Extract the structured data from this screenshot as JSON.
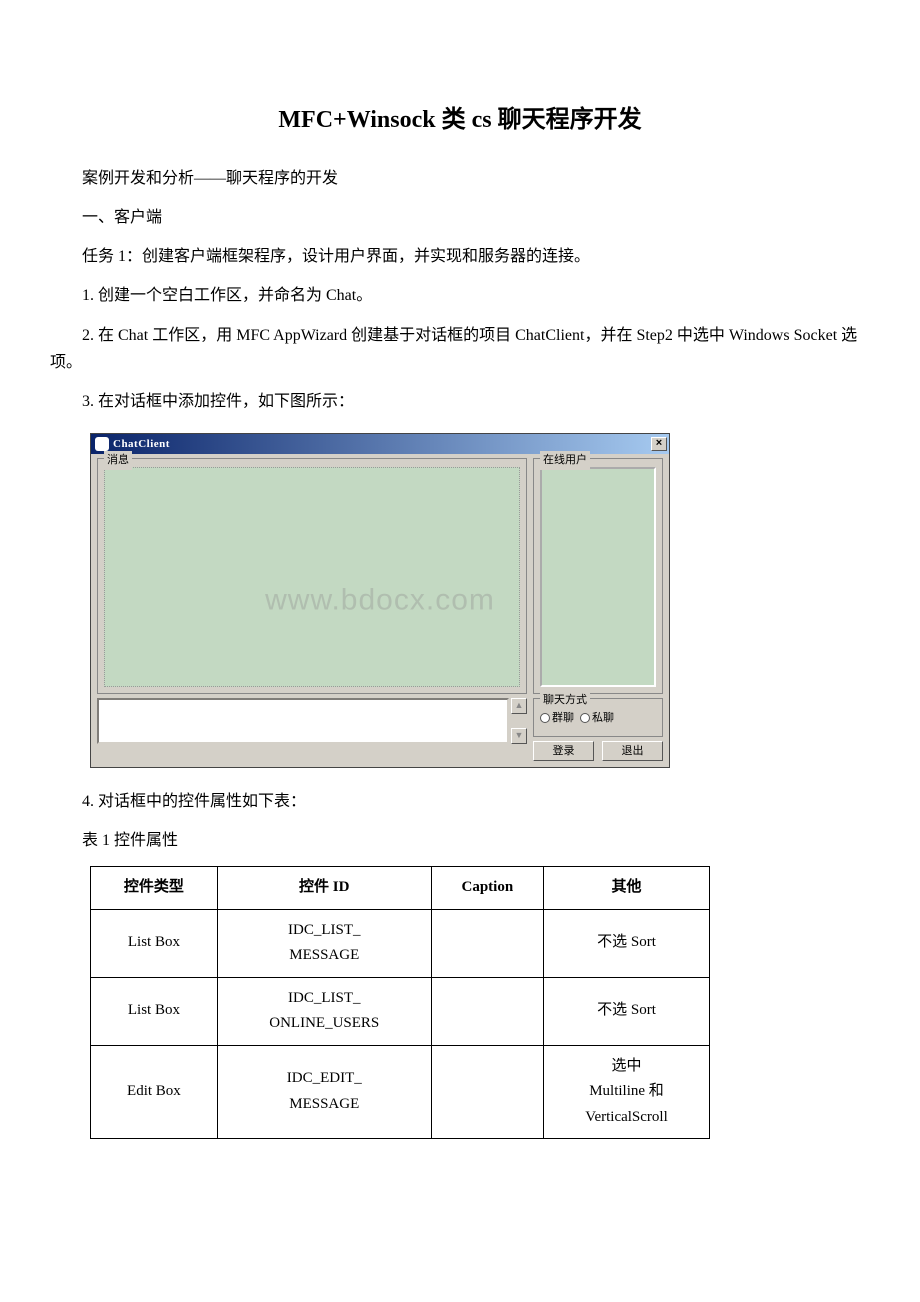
{
  "doc": {
    "title": "MFC+Winsock 类 cs 聊天程序开发",
    "p1": "案例开发和分析——聊天程序的开发",
    "p2": "一、客户端",
    "p3": "任务 1：创建客户端框架程序，设计用户界面，并实现和服务器的连接。",
    "p4": "1. 创建一个空白工作区，并命名为 Chat。",
    "p5": "2. 在 Chat 工作区，用 MFC AppWizard 创建基于对话框的项目 ChatClient，并在 Step2 中选中 Windows Socket 选项。",
    "p6": "3. 在对话框中添加控件，如下图所示：",
    "p7": "4. 对话框中的控件属性如下表：",
    "p8": "表 1 控件属性"
  },
  "dialog": {
    "title": "ChatClient",
    "close": "×",
    "grp_msg": "消息",
    "grp_users": "在线用户",
    "grp_mode": "聊天方式",
    "radio_group": "群聊",
    "radio_private": "私聊",
    "btn_login": "登录",
    "btn_exit": "退出",
    "scroll_up": "▲",
    "scroll_dn": "▼",
    "watermark": "www.bdocx.com"
  },
  "table": {
    "headers": [
      "控件类型",
      "控件 ID",
      "Caption",
      "其他"
    ],
    "rows": [
      {
        "type": "List Box",
        "id": "IDC_LIST_\nMESSAGE",
        "caption": "",
        "other": "不选 Sort"
      },
      {
        "type": "List Box",
        "id": "IDC_LIST_\nONLINE_USERS",
        "caption": "",
        "other": "不选 Sort"
      },
      {
        "type": "Edit Box",
        "id": "IDC_EDIT_\nMESSAGE",
        "caption": "",
        "other": "选中\nMultiline 和\nVerticalScroll"
      }
    ]
  }
}
